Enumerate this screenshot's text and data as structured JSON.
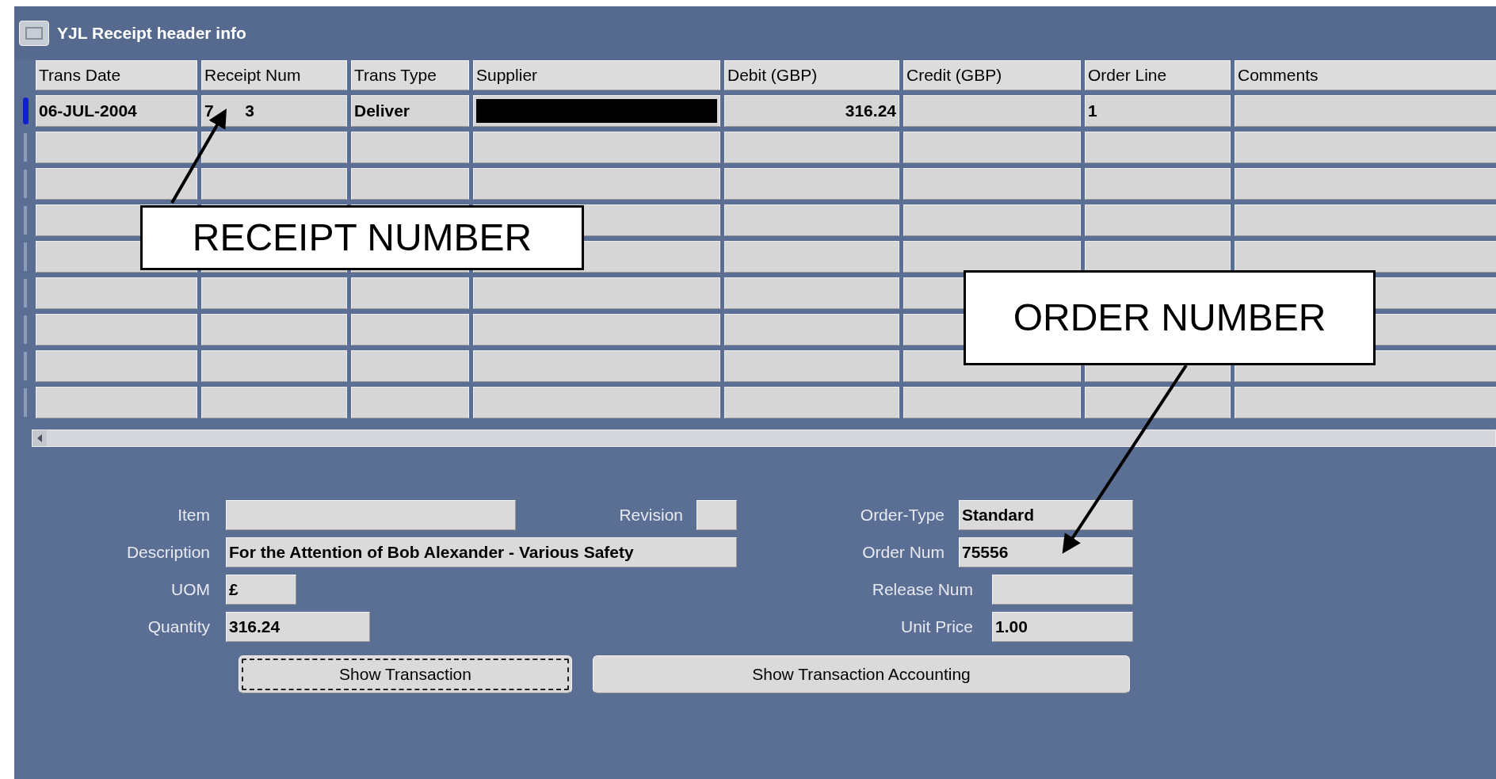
{
  "window": {
    "title": "YJL Receipt header info"
  },
  "table": {
    "columns": [
      "Trans Date",
      "Receipt Num",
      "Trans Type",
      "Supplier",
      "Debit (GBP)",
      "Credit (GBP)",
      "Order Line",
      "Comments"
    ],
    "rows": [
      {
        "selected": true,
        "trans_date": "06-JUL-2004",
        "receipt_num": "7  3",
        "trans_type": "Deliver",
        "supplier_redacted": true,
        "debit": "316.24",
        "order_line": "1"
      },
      {
        "selected": false
      },
      {
        "selected": false
      },
      {
        "selected": false
      },
      {
        "selected": false
      },
      {
        "selected": false
      },
      {
        "selected": false
      },
      {
        "selected": false
      },
      {
        "selected": false
      }
    ]
  },
  "form": {
    "rows": [
      {
        "left": {
          "label": "Item"
        },
        "middle": {
          "label": "Revision"
        },
        "right": {
          "label": "Order-Type",
          "value": "Standard"
        }
      },
      {
        "left": {
          "label": "Description",
          "value": "For the Attention of Bob Alexander - Various Safety"
        },
        "right": {
          "label": "Order Num",
          "value": "75556"
        }
      },
      {
        "left": {
          "label": "UOM",
          "value": "£"
        },
        "right": {
          "label": "Release Num"
        }
      },
      {
        "left": {
          "label": "Quantity",
          "value": "316.24"
        },
        "right": {
          "label": "Unit Price",
          "value": "1.00"
        }
      }
    ]
  },
  "buttons": [
    {
      "label": "Show Transaction",
      "focused": true
    },
    {
      "label": "Show Transaction Accounting",
      "focused": false
    }
  ],
  "callouts": [
    {
      "text": "RECEIPT NUMBER"
    },
    {
      "text": "ORDER NUMBER"
    }
  ]
}
